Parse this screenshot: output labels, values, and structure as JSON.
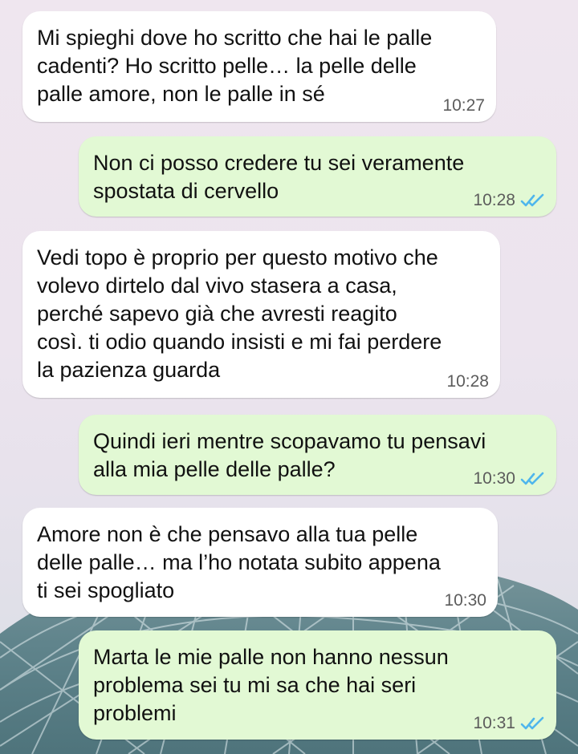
{
  "messages": [
    {
      "direction": "incoming",
      "text": "Mi spieghi dove ho scritto che hai le palle\ncadenti? Ho scritto pelle… la pelle delle\npalle amore, non le palle in sé",
      "time": "10:27",
      "read": false
    },
    {
      "direction": "outgoing",
      "text": "Non ci posso credere tu sei veramente\nspostata di cervello",
      "time": "10:28",
      "read": true
    },
    {
      "direction": "incoming",
      "text": "Vedi topo è proprio per questo motivo che\nvolevo dirtelo dal vivo stasera a casa,\nperché sapevo già che avresti reagito\ncosì. ti odio quando insisti e mi fai perdere\nla pazienza guarda",
      "time": "10:28",
      "read": false
    },
    {
      "direction": "outgoing",
      "text": "Quindi ieri mentre scopavamo tu pensavi\nalla mia pelle delle palle?",
      "time": "10:30",
      "read": true
    },
    {
      "direction": "incoming",
      "text": "Amore non è che pensavo alla tua pelle\ndelle palle… ma l’ho notata subito appena\nti sei spogliato",
      "time": "10:30",
      "read": false
    },
    {
      "direction": "outgoing",
      "text": "Marta le mie palle non hanno nessun\nproblema sei tu mi sa che hai seri\nproblemi",
      "time": "10:31",
      "read": true
    }
  ],
  "colors": {
    "incoming_bubble": "#ffffff",
    "outgoing_bubble": "#e2f9d4",
    "read_ticks": "#4fb6ec",
    "time_text": "#5c5c5c"
  },
  "icons": {
    "read_receipt": "double-check-icon",
    "wallpaper": "glass-dome-wallpaper"
  }
}
